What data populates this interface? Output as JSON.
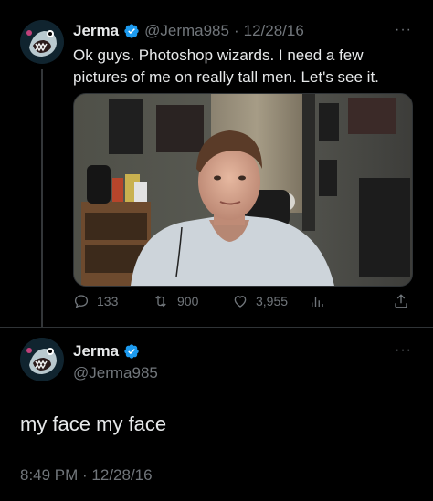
{
  "tweet1": {
    "name": "Jerma",
    "handle": "@Jerma985",
    "date": "12/28/16",
    "text": "Ok guys. Photoshop wizards. I need a few\npictures of me on really tall men. Let's see it.",
    "more": "···",
    "actions": {
      "replies": "133",
      "retweets": "900",
      "likes": "3,955"
    },
    "media_alt": "Photo"
  },
  "tweet2": {
    "name": "Jerma",
    "handle": "@Jerma985",
    "more": "···",
    "text": "my face my face",
    "timestamp": "8:49 PM · 12/28/16"
  },
  "colors": {
    "background": "#000000",
    "text": "#e7e9ea",
    "secondary": "#71767b",
    "verified": "#1d9bf0",
    "border": "#2f3336"
  },
  "icons": [
    "verified-badge-icon",
    "more-icon",
    "reply-icon",
    "retweet-icon",
    "like-icon",
    "analytics-icon",
    "share-icon"
  ]
}
